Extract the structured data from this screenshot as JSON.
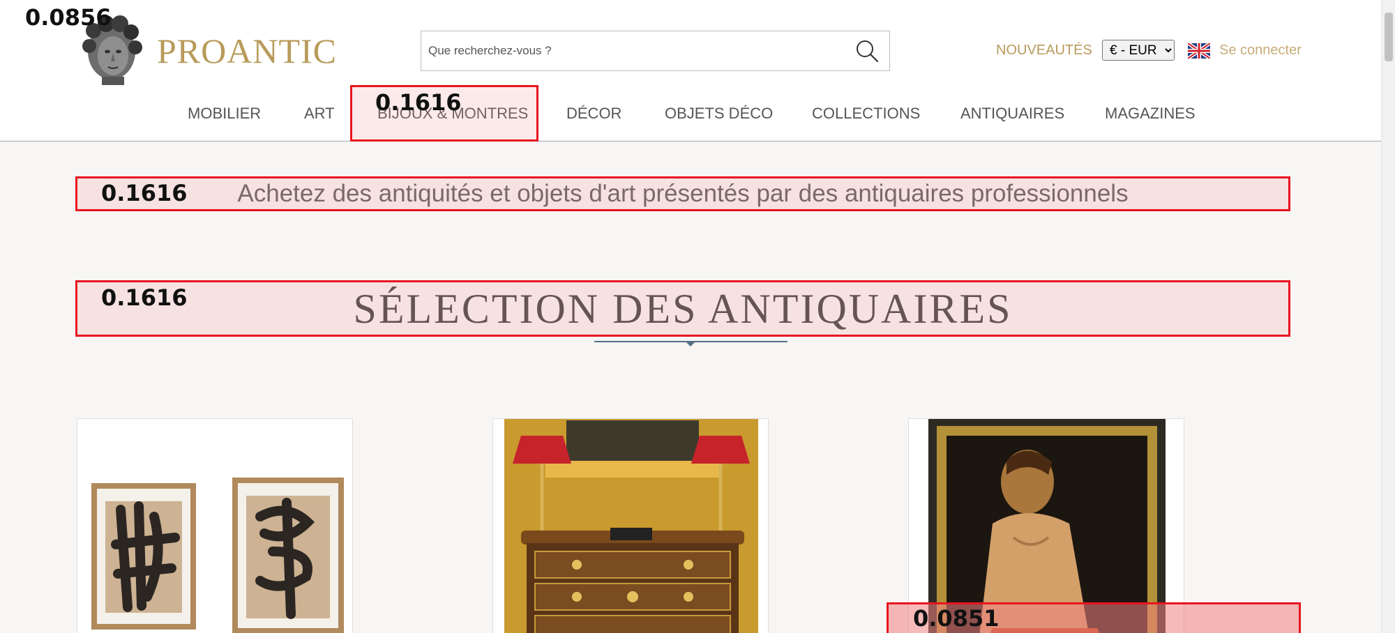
{
  "header": {
    "logo_text": "PROANTIC",
    "search_placeholder": "Que recherchez-vous ?",
    "nouveautes": "NOUVEAUTÉS",
    "currency_selected": "€ - EUR",
    "login": "Se connecter",
    "flag_icon": "uk-flag-icon"
  },
  "nav": {
    "items": [
      "MOBILIER",
      "ART",
      "BIJOUX & MONTRES",
      "DÉCOR",
      "OBJETS DÉCO",
      "COLLECTIONS",
      "ANTIQUAIRES",
      "MAGAZINES"
    ]
  },
  "main": {
    "tagline": "Achetez des antiquités et objets d'art présentés par des antiquaires professionnels",
    "section_title": "SÉLECTION DES ANTIQUAIRES"
  },
  "overlays": {
    "top_left_label": "0.0856",
    "nav_label": "0.1616",
    "tagline_label": "0.1616",
    "title_label": "0.1616",
    "card_label": "0.0851"
  },
  "colors": {
    "brand_gold": "#b89a5a",
    "overlay_red": "#e8141f",
    "divider_blue": "#557085"
  }
}
